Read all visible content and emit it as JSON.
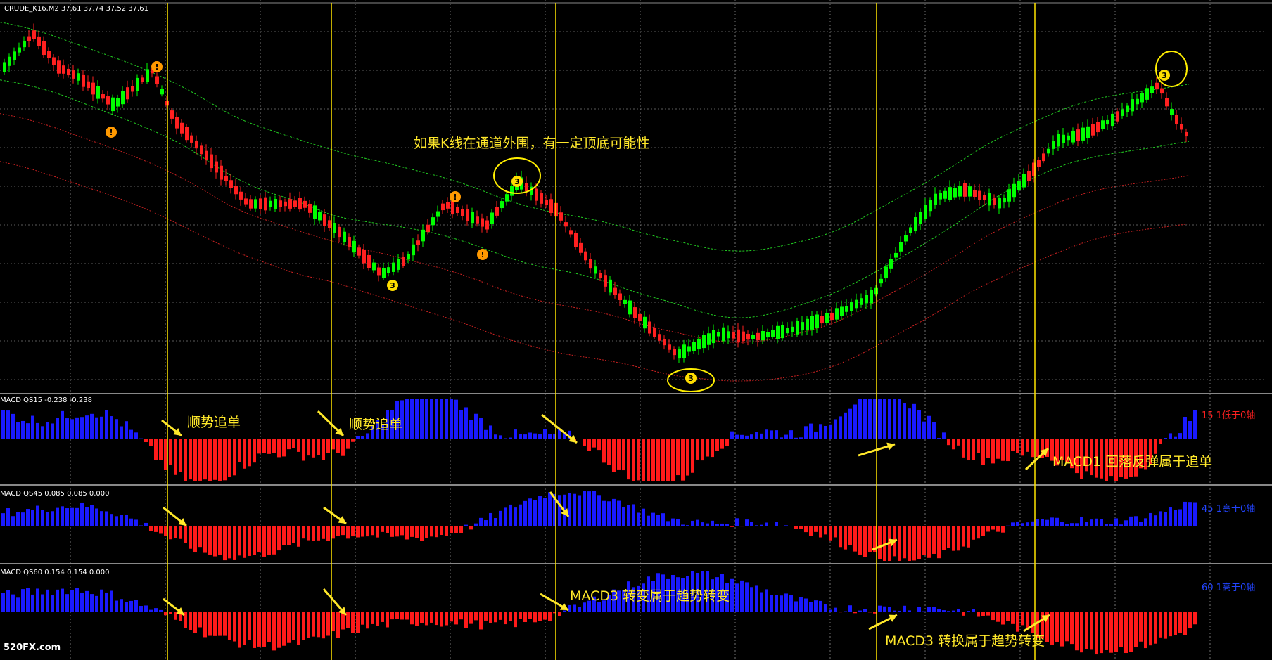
{
  "header": {
    "symbol_info": "CRUDE_K16,M2  37.61 37.74 37.52 37.61"
  },
  "panels": [
    {
      "title": "MACD QS15 -0.238 -0.238",
      "side_label": "15 1低于0轴"
    },
    {
      "title": "MACD QS45 0.085 0.085 0.000",
      "side_label": "45 1高于0轴"
    },
    {
      "title": "MACD QS60 0.154 0.154 0.000",
      "side_label": "60 1高于0轴"
    }
  ],
  "annotations": {
    "channel_note": "如果K线在通道外围，有一定顶底可能性",
    "trend_follow_1": "顺势追单",
    "trend_follow_2": "顺势追单",
    "macd1_note": "MACD1 回落反弹属于追单",
    "macd3_change": "MACD3 转变属于趋势转变",
    "macd3_switch": "MACD3 转换属于趋势转变"
  },
  "markers": [
    "3",
    "!"
  ],
  "watermark": "520FX.com",
  "colors": {
    "background": "#000000",
    "bull_candle": "#00ff00",
    "bear_candle": "#ff2020",
    "hist_positive": "#1a1aff",
    "hist_negative": "#ff1a1a",
    "upper_band": "#22cc22",
    "lower_band": "#cc2222",
    "annotation": "#ffe82a",
    "vline": "#ffe600",
    "marker_orange": "#ff9900"
  }
}
